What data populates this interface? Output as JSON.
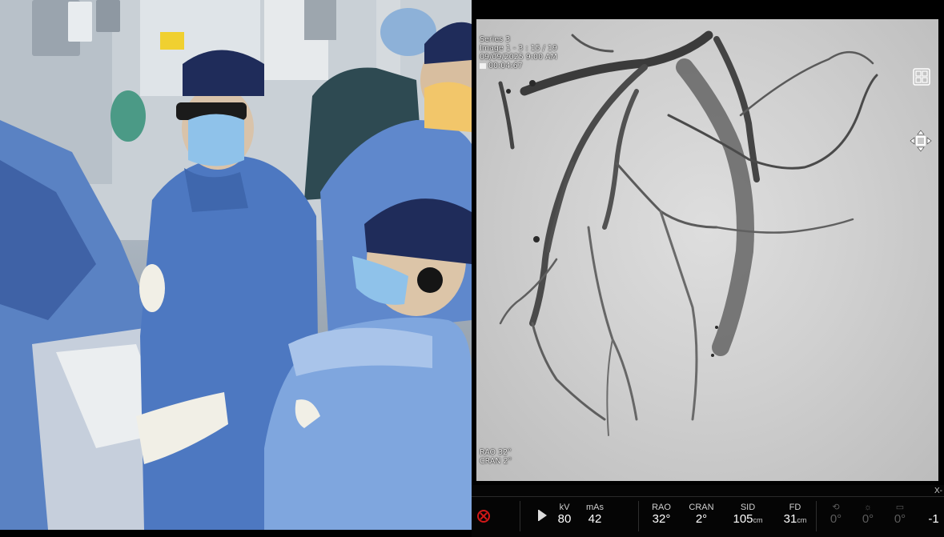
{
  "overlay": {
    "series": "Series 3",
    "image": "Image 1 - 3 : 15 / 19",
    "datetime": "09/09/2025 9:00 AM",
    "timer": "00:04:67",
    "rao_angle": "RAO  32°",
    "cran_angle": "CRAN  2°"
  },
  "statusbar": {
    "x_label": "X-",
    "kv_label": "kV",
    "kv_value": "80",
    "mas_label": "mAs",
    "mas_value": "42",
    "rao_label": "RAO",
    "rao_value": "32°",
    "cran_label": "CRAN",
    "cran_value": "2°",
    "sid_label": "SID",
    "sid_value": "105",
    "sid_unit": "cm",
    "fd_label": "FD",
    "fd_value": "31",
    "fd_unit": "cm",
    "dim1_value": "0°",
    "dim2_value": "0°",
    "dim3_value": "0°",
    "dim4_value": "-1"
  },
  "colors": {
    "scrub_blue": "#4f79c2",
    "cap_navy": "#1f2c5a",
    "background_black": "#000000",
    "vessel_dark": "#3a3a3a",
    "xray_off_red": "#d01818"
  },
  "icons": [
    "xray-off-icon",
    "play-icon",
    "grid-layout-icon",
    "move-icon"
  ]
}
